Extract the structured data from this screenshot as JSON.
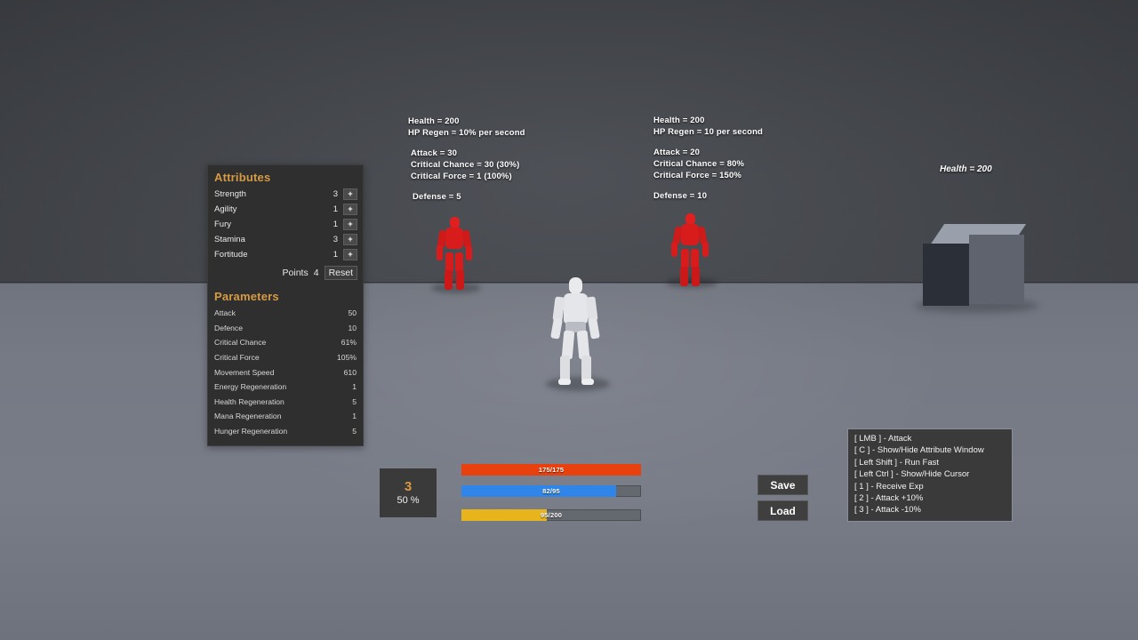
{
  "scene": {
    "background_wall_color": "#44474d",
    "background_floor_color": "#767a85",
    "player_color": "#e9eaec",
    "enemy_color": "#e02020",
    "cube_color": "#5e636e"
  },
  "attributes_window": {
    "title": "Attributes",
    "rows": [
      {
        "name": "Strength",
        "value": "3",
        "button": "+"
      },
      {
        "name": "Agility",
        "value": "1",
        "button": "+"
      },
      {
        "name": "Fury",
        "value": "1",
        "button": "+"
      },
      {
        "name": "Stamina",
        "value": "3",
        "button": "+"
      },
      {
        "name": "Fortitude",
        "value": "1",
        "button": "+"
      }
    ],
    "points_label": "Points",
    "points_value": "4",
    "reset_label": "Reset"
  },
  "parameters_window": {
    "title": "Parameters",
    "rows": [
      {
        "name": "Attack",
        "value": "50"
      },
      {
        "name": "Defence",
        "value": "10"
      },
      {
        "name": "Critical Chance",
        "value": "61%"
      },
      {
        "name": "Critical Force",
        "value": "105%"
      },
      {
        "name": "Movement Speed",
        "value": "610"
      },
      {
        "name": "Energy Regeneration",
        "value": "1"
      },
      {
        "name": "Health Regeneration",
        "value": "5"
      },
      {
        "name": "Mana Regeneration",
        "value": "1"
      },
      {
        "name": "Hunger Regeneration",
        "value": "5"
      }
    ]
  },
  "enemy_one": {
    "health": "Health = 200",
    "hp_regen": "HP Regen = 10% per second",
    "attack": "Attack = 30",
    "critical_chance": "Critical Chance = 30 (30%)",
    "critical_force": "Critical Force = 1 (100%)",
    "defense": "Defense = 5"
  },
  "enemy_two": {
    "health": "Health = 200",
    "hp_regen": "HP Regen = 10 per second",
    "attack": "Attack = 20",
    "critical_chance": "Critical Chance = 80%",
    "critical_force": "Critical Force = 150%",
    "defense": "Defense = 10"
  },
  "cube_target": {
    "health": "Health = 200"
  },
  "hud": {
    "level": "3",
    "experience_percent": "50 %",
    "bars": [
      {
        "name": "health",
        "text": "175/175",
        "percent": 100,
        "color": "#e8410e"
      },
      {
        "name": "mana",
        "text": "82/95",
        "percent": 86,
        "color": "#2f86e8"
      },
      {
        "name": "hunger",
        "text": "95/200",
        "percent": 47.5,
        "color": "#e8b41c"
      }
    ],
    "save_label": "Save",
    "load_label": "Load"
  },
  "keybinds": {
    "lines": [
      "[ LMB ] - Attack",
      "[ C ] - Show/Hide Attribute Window",
      "[ Left Shift ] - Run Fast",
      "[ Left Ctrl ] - Show/Hide Cursor",
      "[ 1 ] - Receive Exp",
      "[ 2 ] - Attack +10%",
      "[ 3 ] - Attack -10%"
    ]
  }
}
